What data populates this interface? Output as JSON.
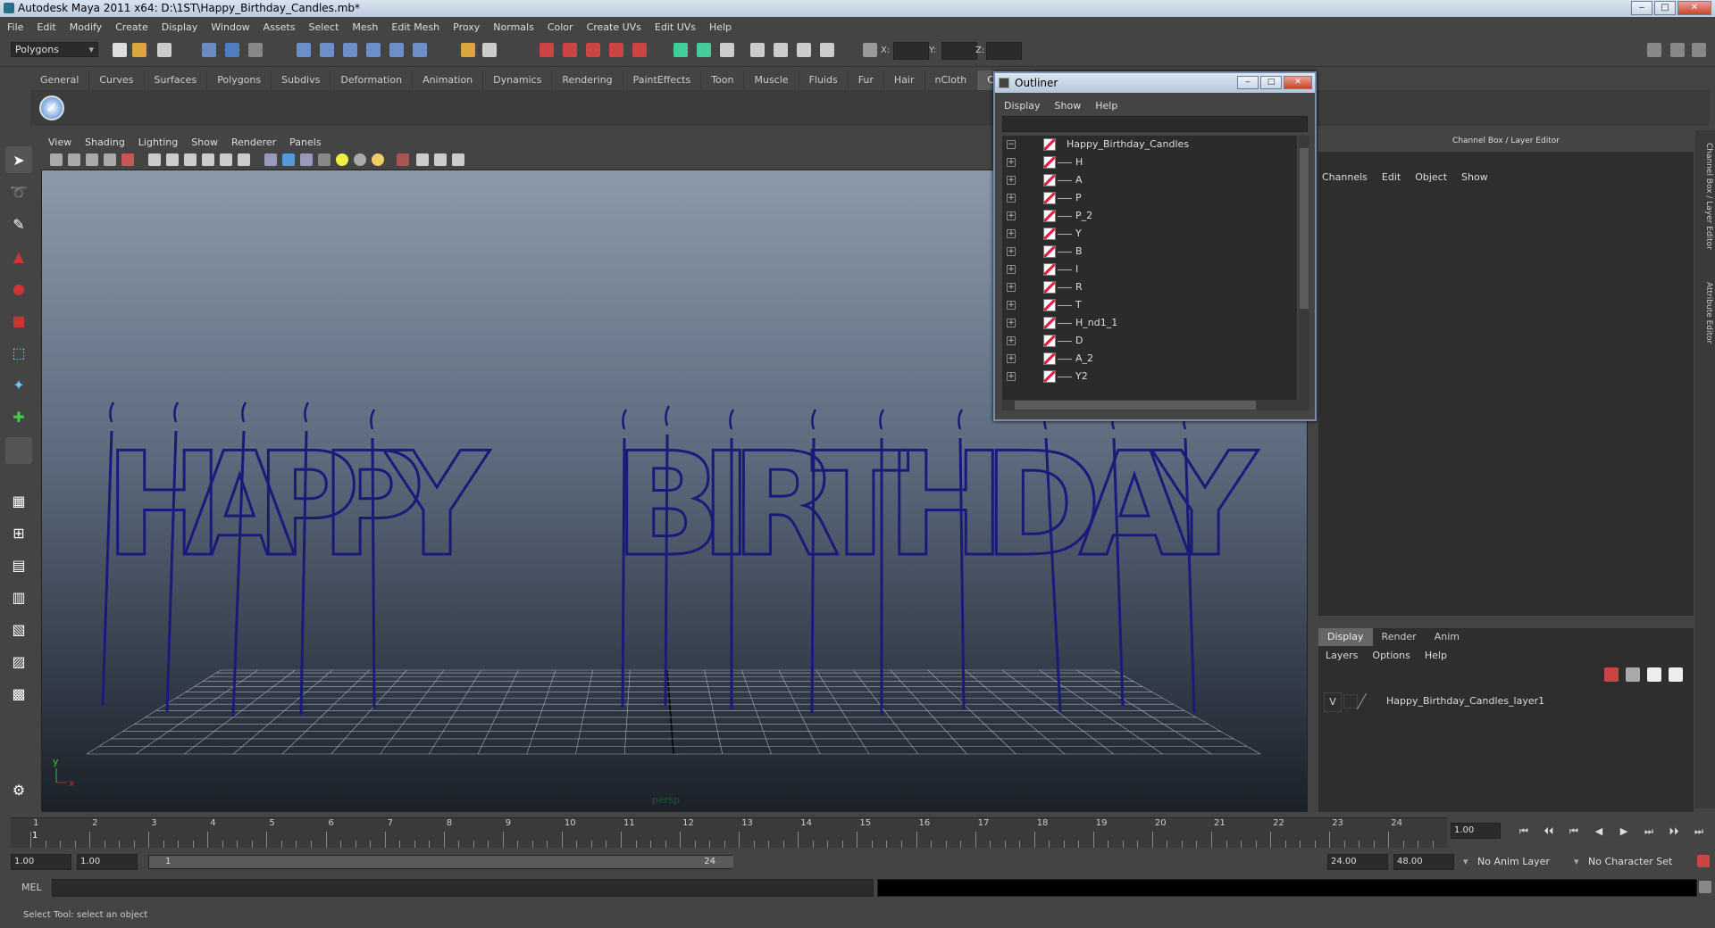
{
  "window": {
    "title": "Autodesk Maya 2011 x64: D:\\1ST\\Happy_Birthday_Candles.mb*",
    "minimize": "‒",
    "maximize": "□",
    "close": "✕"
  },
  "menubar": [
    "File",
    "Edit",
    "Modify",
    "Create",
    "Display",
    "Window",
    "Assets",
    "Select",
    "Mesh",
    "Edit Mesh",
    "Proxy",
    "Normals",
    "Color",
    "Create UVs",
    "Edit UVs",
    "Help"
  ],
  "statusline": {
    "mode": "Polygons",
    "x_label": "X:",
    "y_label": "Y:",
    "z_label": "Z:"
  },
  "shelf_tabs": [
    "General",
    "Curves",
    "Surfaces",
    "Polygons",
    "Subdivs",
    "Deformation",
    "Animation",
    "Dynamics",
    "Rendering",
    "PaintEffects",
    "Toon",
    "Muscle",
    "Fluids",
    "Fur",
    "Hair",
    "nCloth",
    "Custom"
  ],
  "shelf_active": "Custom",
  "viewport": {
    "menu": [
      "View",
      "Shading",
      "Lighting",
      "Show",
      "Renderer",
      "Panels"
    ],
    "camera_label": "persp",
    "axis_y": "y",
    "axis_x": "x",
    "text_word1": "HAPPY",
    "text_word2": "BIRTHDAY",
    "wire_color": "#1a1a7a"
  },
  "outliner": {
    "title": "Outliner",
    "menu": [
      "Display",
      "Show",
      "Help"
    ],
    "root": "Happy_Birthday_Candles",
    "items": [
      "H",
      "A",
      "P",
      "P_2",
      "Y",
      "B",
      "I",
      "R",
      "T",
      "H_nd1_1",
      "D",
      "A_2",
      "Y2"
    ]
  },
  "channel_box": {
    "title": "Channel Box / Layer Editor",
    "menu": [
      "Channels",
      "Edit",
      "Object",
      "Show"
    ]
  },
  "side_tabs": [
    "Channel Box / Layer Editor",
    "Attribute Editor"
  ],
  "layer_editor": {
    "tabs": [
      "Display",
      "Render",
      "Anim"
    ],
    "active_tab": "Display",
    "menu": [
      "Layers",
      "Options",
      "Help"
    ],
    "layer": {
      "visible": "V",
      "name": "Happy_Birthday_Candles_layer1"
    }
  },
  "timeline": {
    "frames": [
      "1",
      "2",
      "3",
      "4",
      "5",
      "6",
      "7",
      "8",
      "9",
      "10",
      "11",
      "12",
      "13",
      "14",
      "15",
      "16",
      "17",
      "18",
      "19",
      "20",
      "21",
      "22",
      "23",
      "24"
    ],
    "current_frame": "1",
    "current_time_field": "1.00",
    "playback_buttons": [
      "⏮",
      "⏴⏴",
      "⏮",
      "◀",
      "▶",
      "⏭",
      "⏵⏵",
      "⏭"
    ]
  },
  "range": {
    "start": "1.00",
    "start2": "1.00",
    "slider_start": "1",
    "slider_end": "24",
    "end": "24.00",
    "end2": "48.00",
    "anim_layer": "No Anim Layer",
    "char_set": "No Character Set"
  },
  "command": {
    "label": "MEL"
  },
  "helpline": "Select Tool: select an object"
}
